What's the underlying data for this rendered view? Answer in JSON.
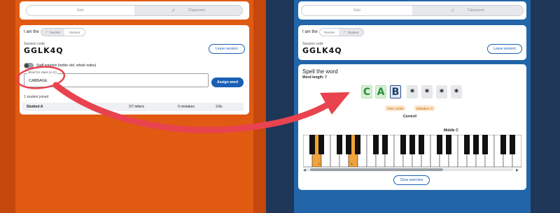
{
  "left": {
    "mode_tabs": [
      "Solo",
      "Classroom"
    ],
    "role_label": "I am the",
    "roles": [
      "Teacher",
      "Student"
    ],
    "session_label": "Session code",
    "session_code": "GGLK4Q",
    "leave_label": "Leave session",
    "staff_label": "Staff notation (treble clef, whole notes)",
    "word_label": "Word for class (A-G)",
    "word_value": "CABBAGE",
    "assign_label": "Assign word",
    "joined_text": "1 student joined",
    "student": {
      "name": "Student A",
      "progress": "2/7 letters",
      "mistakes": "0 mistakes",
      "time": "3.8s"
    }
  },
  "right": {
    "mode_tabs": [
      "Solo",
      "Classroom"
    ],
    "role_label": "I am the",
    "roles": [
      "Teacher",
      "Student"
    ],
    "session_label": "Session code",
    "session_code": "GGLK4Q",
    "leave_label": "Leave session",
    "spell_title": "Spell the word",
    "word_length": "Word length: 7",
    "tiles": [
      "C",
      "A",
      "B",
      "*",
      "*",
      "*",
      "*"
    ],
    "time_label": "Time: 6.00s",
    "mistakes_label": "Mistakes: 0",
    "feedback": "Correct!",
    "middle_c": "Middle C",
    "key_labels": [
      "C",
      "A"
    ],
    "clear_label": "Clear selection"
  },
  "colors": {
    "left_bg": "#e15a12",
    "right_bg": "#2265a8",
    "accent_blue": "#1a5fb4",
    "arrow_red": "#e8434e",
    "highlight_orange": "#f2a23a"
  }
}
